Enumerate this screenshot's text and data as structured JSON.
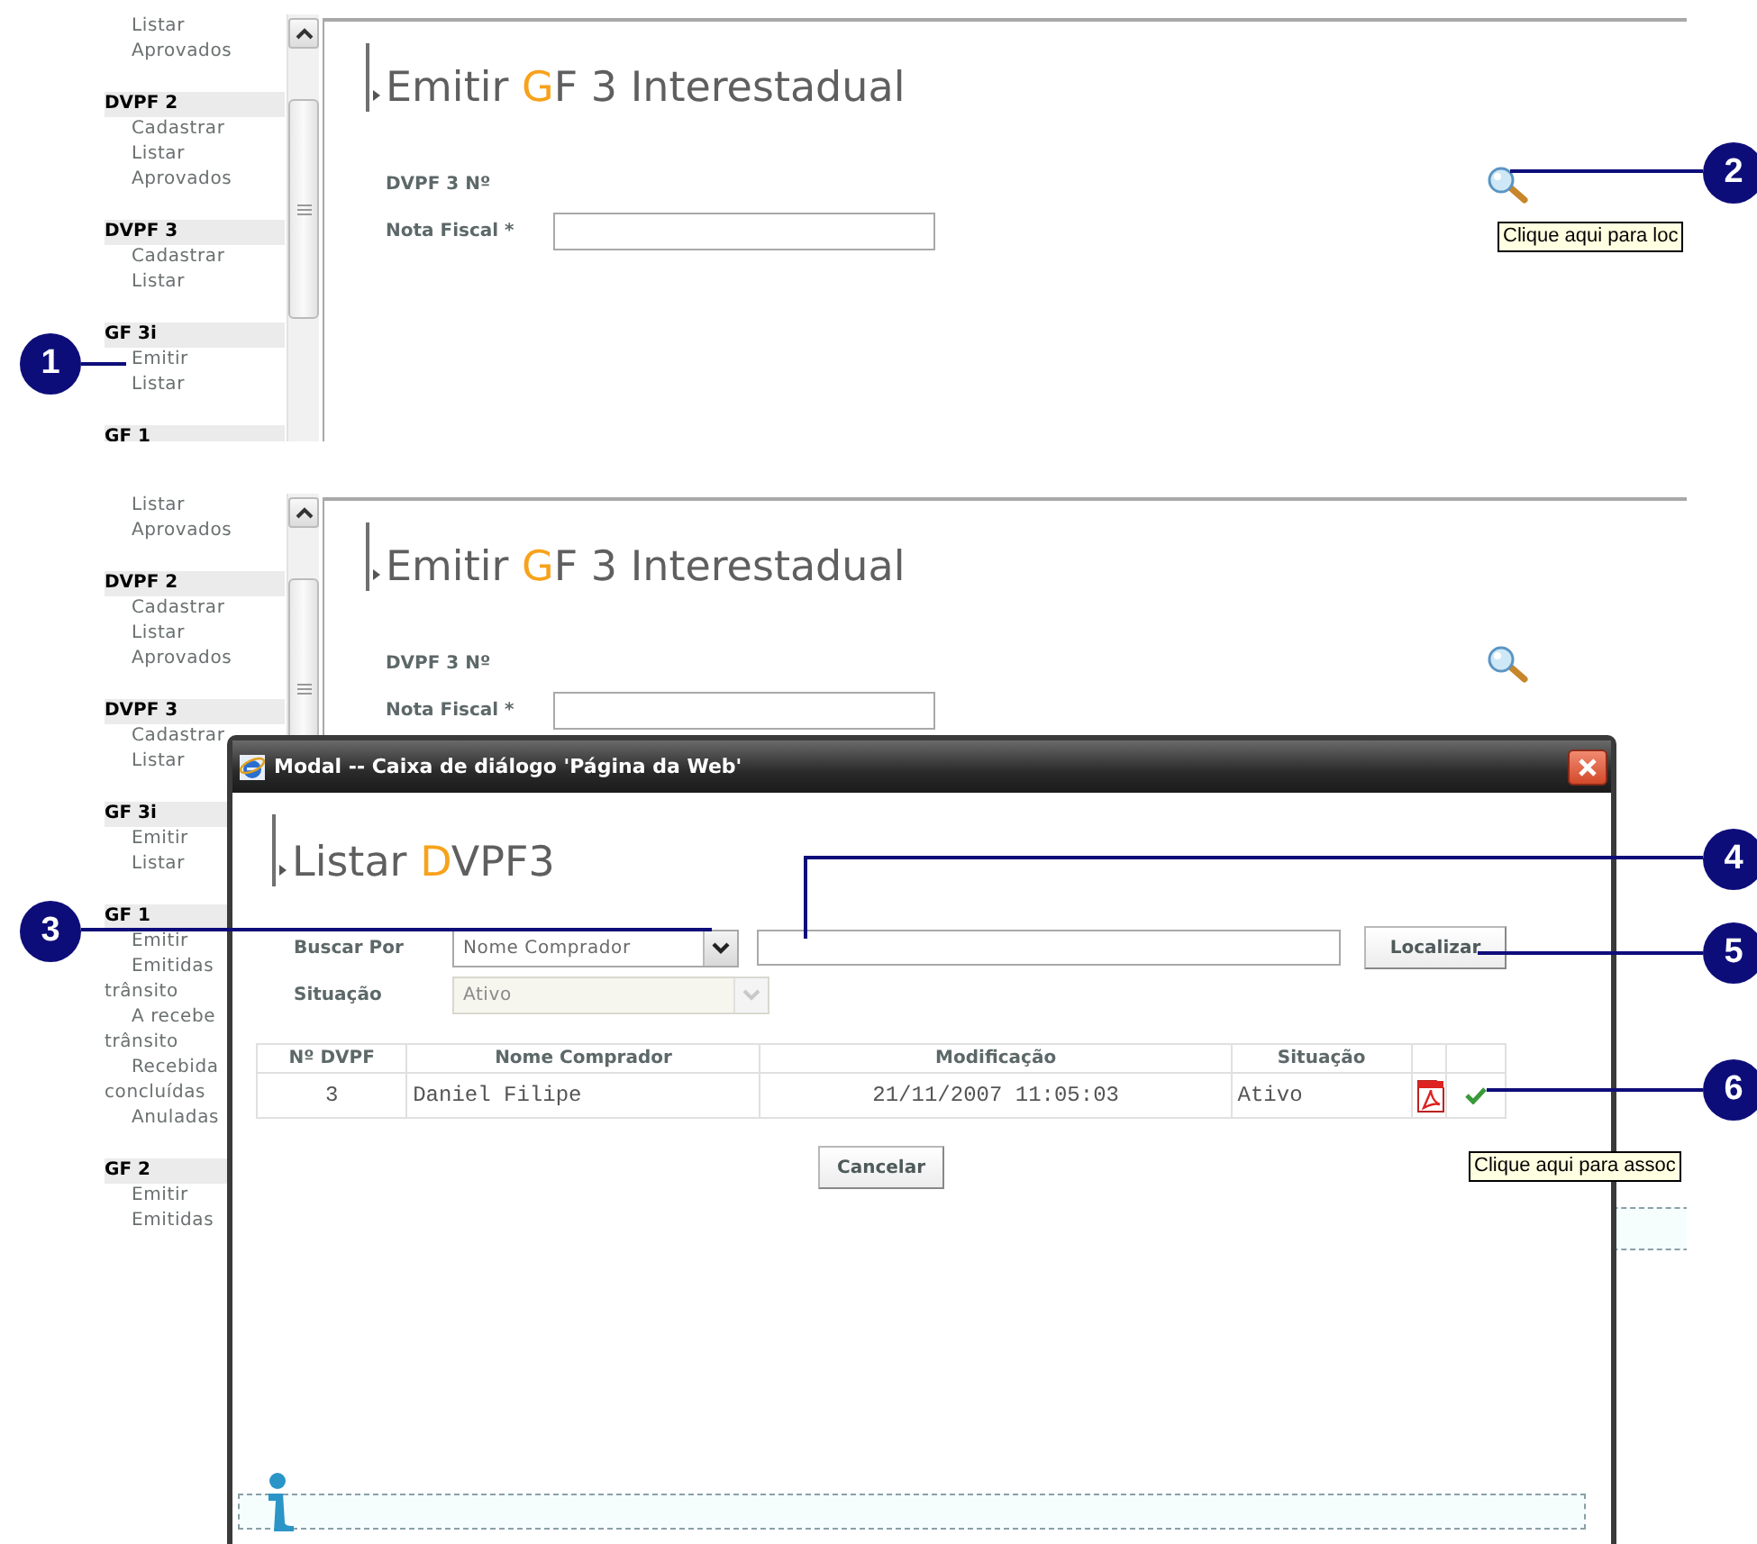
{
  "screens": [
    {
      "sidebar": [
        {
          "items": [
            {
              "label": "Listar",
              "kind": "link"
            },
            {
              "label": "Aprovados",
              "kind": "link"
            }
          ]
        },
        {
          "header": "DVPF 2",
          "items": [
            {
              "label": "Cadastrar",
              "kind": "link"
            },
            {
              "label": "Listar",
              "kind": "link"
            },
            {
              "label": "Aprovados",
              "kind": "link"
            }
          ]
        },
        {
          "header": "DVPF 3",
          "items": [
            {
              "label": "Cadastrar",
              "kind": "link"
            },
            {
              "label": "Listar",
              "kind": "link"
            }
          ]
        },
        {
          "header": "GF 3i",
          "items": [
            {
              "label": "Emitir",
              "kind": "link"
            },
            {
              "label": "Listar",
              "kind": "link"
            }
          ]
        },
        {
          "header": "GF 1"
        }
      ],
      "title_parts": [
        "Emitir ",
        "G",
        "F 3 Interestadual"
      ],
      "dvpf_label": "DVPF 3 Nº",
      "nota_label": "Nota Fiscal *",
      "tooltip": "Clique aqui para loc"
    },
    {
      "sidebar": [
        {
          "items": [
            {
              "label": "Listar",
              "kind": "link"
            },
            {
              "label": "Aprovados",
              "kind": "link"
            }
          ]
        },
        {
          "header": "DVPF 2",
          "items": [
            {
              "label": "Cadastrar",
              "kind": "link"
            },
            {
              "label": "Listar",
              "kind": "link"
            },
            {
              "label": "Aprovados",
              "kind": "link"
            }
          ]
        },
        {
          "header": "DVPF 3",
          "items": [
            {
              "label": "Cadastrar",
              "kind": "link"
            },
            {
              "label": "Listar",
              "kind": "link"
            }
          ]
        },
        {
          "header": "GF 3i",
          "items": [
            {
              "label": "Emitir",
              "kind": "link"
            },
            {
              "label": "Listar",
              "kind": "link"
            }
          ]
        },
        {
          "header": "GF 1",
          "items": [
            {
              "label": "Emitir",
              "kind": "link"
            },
            {
              "label": "Emitidas",
              "kind": "link"
            },
            {
              "label": "trânsito",
              "kind": "continuation"
            },
            {
              "label": "A recebe",
              "kind": "link"
            },
            {
              "label": "trânsito",
              "kind": "continuation"
            },
            {
              "label": "Recebida",
              "kind": "link"
            },
            {
              "label": "concluídas",
              "kind": "continuation"
            },
            {
              "label": "Anuladas",
              "kind": "link"
            }
          ]
        },
        {
          "header": "GF 2",
          "items": [
            {
              "label": "Emitir",
              "kind": "link"
            },
            {
              "label": "Emitidas",
              "kind": "link"
            }
          ]
        }
      ],
      "title_parts": [
        "Emitir ",
        "G",
        "F 3 Interestadual"
      ],
      "dvpf_label": "DVPF 3 Nº",
      "nota_label": "Nota Fiscal *"
    }
  ],
  "modal": {
    "title": "Modal -- Caixa de diálogo 'Página da Web'",
    "heading_parts": [
      "Listar ",
      "D",
      "VPF3"
    ],
    "search_label": "Buscar Por",
    "search_by": "Nome Comprador",
    "locate_button": "Localizar",
    "status_label": "Situação",
    "status_value": "Ativo",
    "status_disabled": true,
    "columns": [
      "Nº DVPF",
      "Nome Comprador",
      "Modificação",
      "Situação"
    ],
    "rows": [
      {
        "cells": [
          "3",
          "Daniel Filipe",
          "21/11/2007 11:05:03",
          "Ativo"
        ]
      }
    ],
    "cancel_button": "Cancelar",
    "tooltip": "Clique aqui para assoc"
  },
  "callouts": [
    "1",
    "2",
    "3",
    "4",
    "5",
    "6"
  ]
}
